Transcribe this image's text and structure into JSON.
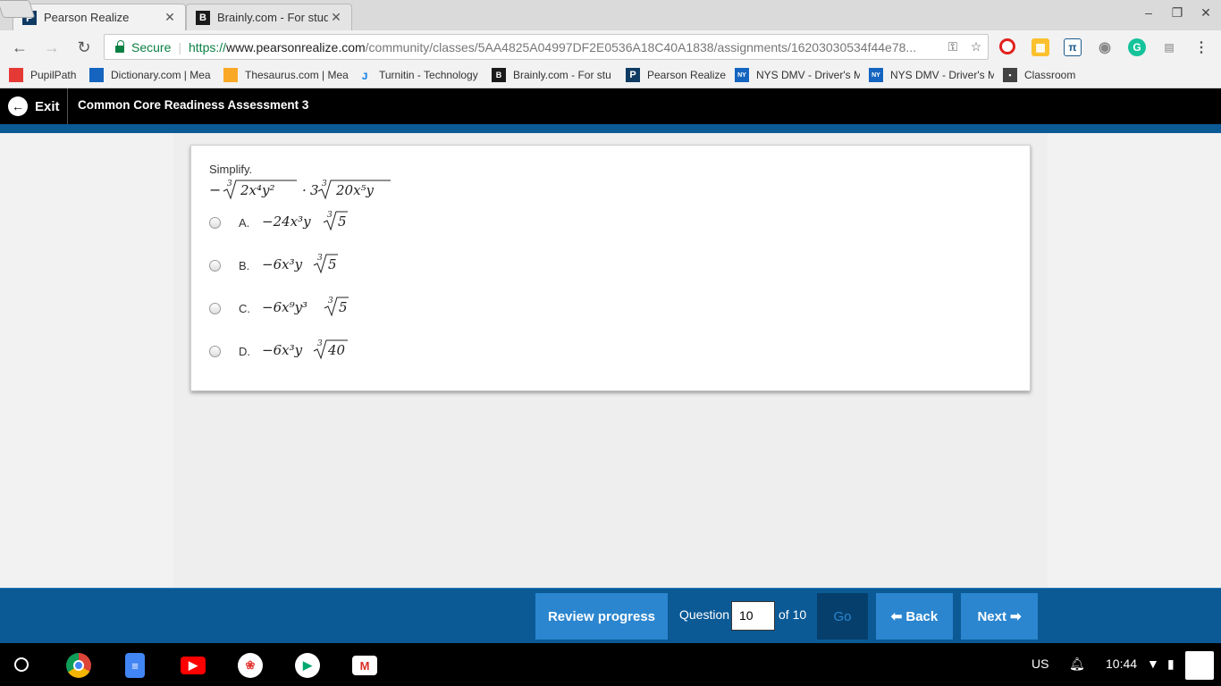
{
  "browser": {
    "tabs": [
      {
        "title": "Pearson Realize",
        "favicon": "pearson-p-icon",
        "active": true
      },
      {
        "title": "Brainly.com - For studen",
        "favicon": "brainly-b-icon",
        "active": false
      }
    ],
    "secure_label": "Secure",
    "url_scheme": "https://",
    "url_host": "www.pearsonrealize.com",
    "url_path": "/community/classes/5AA4825A04997DF2E0536A18C40A1838/assignments/16203030534f44e78..."
  },
  "bookmarks": [
    {
      "label": "PupilPath",
      "icon": "pupilpath-icon",
      "color": "#e53935"
    },
    {
      "label": "Dictionary.com | Mea",
      "icon": "dictionary-icon",
      "color": "#1565c0"
    },
    {
      "label": "Thesaurus.com | Mea",
      "icon": "thesaurus-icon",
      "color": "#f9a825"
    },
    {
      "label": "Turnitin - Technology",
      "icon": "turnitin-icon",
      "color": "#1e88e5"
    },
    {
      "label": "Brainly.com - For stu",
      "icon": "brainly-icon",
      "color": "#1a1a1a"
    },
    {
      "label": "Pearson Realize",
      "icon": "pearson-icon",
      "color": "#0f3b63"
    },
    {
      "label": "NYS DMV - Driver's M",
      "icon": "nysdmv-icon",
      "color": "#1565c0"
    },
    {
      "label": "NYS DMV - Driver's M",
      "icon": "nysdmv-icon",
      "color": "#1565c0"
    },
    {
      "label": "Classroom",
      "icon": "classroom-icon",
      "color": "#424242"
    }
  ],
  "app": {
    "exit_label": "Exit",
    "assessment_title": "Common Core Readiness Assessment 3"
  },
  "question": {
    "prompt": "Simplify.",
    "expression": {
      "neg": "−",
      "root1_index": "3",
      "root1_body": "2x⁴y²",
      "dot": "·",
      "coef": "3",
      "root2_index": "3",
      "root2_body": "20x⁵y"
    },
    "choices": [
      {
        "letter": "A.",
        "prefix": "−24x³y",
        "index": "3",
        "radicand": "5"
      },
      {
        "letter": "B.",
        "prefix": "−6x³y",
        "index": "3",
        "radicand": "5"
      },
      {
        "letter": "C.",
        "prefix": "−6x⁹y³",
        "index": "3",
        "radicand": "5"
      },
      {
        "letter": "D.",
        "prefix": "−6x³y",
        "index": "3",
        "radicand": "40"
      }
    ]
  },
  "footer": {
    "review_label": "Review progress",
    "question_label": "Question",
    "question_value": "10",
    "of_label": "of 10",
    "go_label": "Go",
    "back_label": "Back",
    "next_label": "Next"
  },
  "shelf": {
    "locale": "US",
    "time": "10:44"
  },
  "colors": {
    "brand_blue": "#0b5a96",
    "button_blue": "#2b86cf",
    "go_dark": "#063f6c"
  }
}
